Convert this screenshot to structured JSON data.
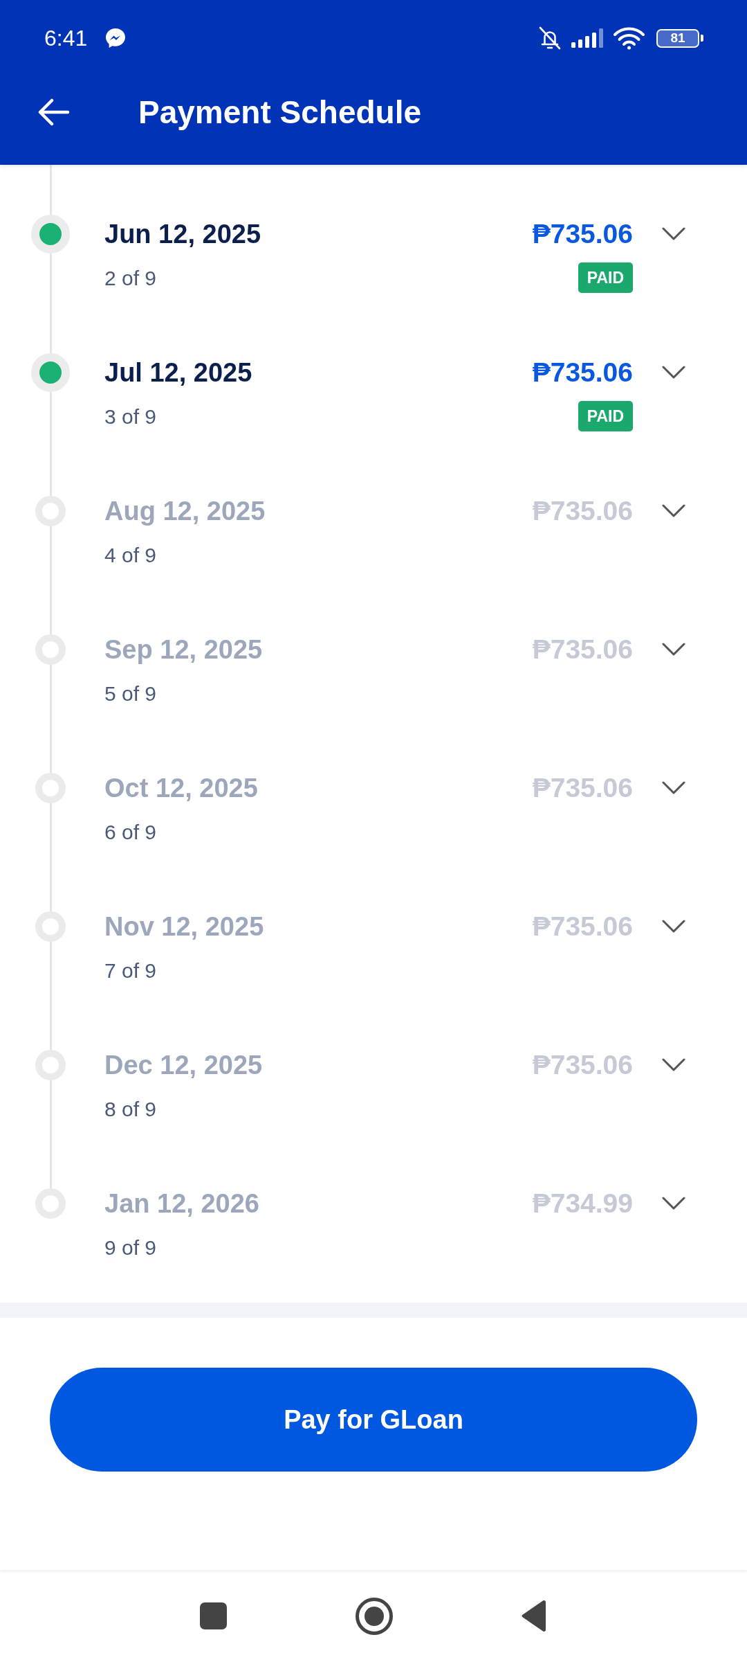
{
  "status_bar": {
    "time": "6:41",
    "battery": "81"
  },
  "app_bar": {
    "title": "Payment Schedule"
  },
  "schedule": [
    {
      "date": "Jun 12, 2025",
      "installment": "2 of 9",
      "amount": "₱735.06",
      "paid": true,
      "badge": "PAID",
      "expanded": false
    },
    {
      "date": "Jul 12, 2025",
      "installment": "3 of 9",
      "amount": "₱735.06",
      "paid": true,
      "badge": "PAID",
      "expanded": false
    },
    {
      "date": "Aug 12, 2025",
      "installment": "4 of 9",
      "amount": "₱735.06",
      "paid": false,
      "expanded": false
    },
    {
      "date": "Sep 12, 2025",
      "installment": "5 of 9",
      "amount": "₱735.06",
      "paid": false,
      "expanded": false
    },
    {
      "date": "Oct 12, 2025",
      "installment": "6 of 9",
      "amount": "₱735.06",
      "paid": false,
      "expanded": false
    },
    {
      "date": "Nov 12, 2025",
      "installment": "7 of 9",
      "amount": "₱735.06",
      "paid": false,
      "expanded": false
    },
    {
      "date": "Dec 12, 2025",
      "installment": "8 of 9",
      "amount": "₱735.06",
      "paid": false,
      "expanded": false
    },
    {
      "date": "Jan 12, 2026",
      "installment": "9 of 9",
      "amount": "₱734.99",
      "paid": false,
      "expanded": false
    }
  ],
  "pay_button": {
    "label": "Pay for GLoan"
  }
}
